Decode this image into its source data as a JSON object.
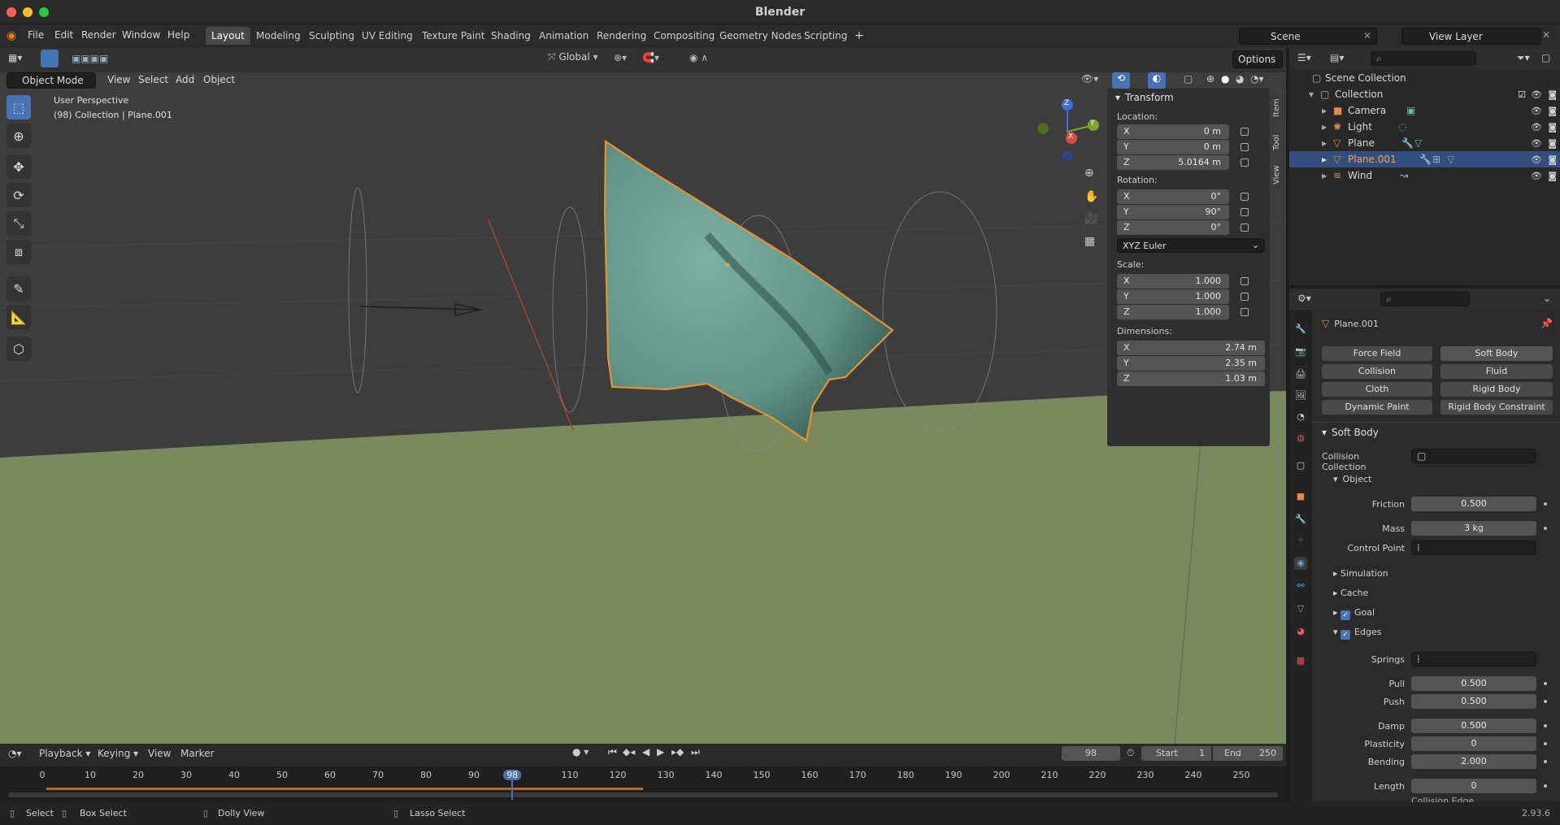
{
  "app_title": "Blender",
  "menu": [
    "File",
    "Edit",
    "Render",
    "Window",
    "Help"
  ],
  "workspaces": [
    "Layout",
    "Modeling",
    "Sculpting",
    "UV Editing",
    "Texture Paint",
    "Shading",
    "Animation",
    "Rendering",
    "Compositing",
    "Geometry Nodes",
    "Scripting"
  ],
  "active_workspace": "Layout",
  "scene_name": "Scene",
  "view_layer": "View Layer",
  "viewport": {
    "mode": "Object Mode",
    "menus": [
      "View",
      "Select",
      "Add",
      "Object"
    ],
    "transform_orientation": "Global",
    "options_label": "Options",
    "info_line1": "User Perspective",
    "info_line2": "(98) Collection | Plane.001",
    "gizmo_axes": [
      "Z",
      "Y",
      "X"
    ]
  },
  "npanel": {
    "header": "Transform",
    "location_label": "Location:",
    "location": [
      {
        "axis": "X",
        "value": "0 m"
      },
      {
        "axis": "Y",
        "value": "0 m"
      },
      {
        "axis": "Z",
        "value": "5.0164 m"
      }
    ],
    "rotation_label": "Rotation:",
    "rotation": [
      {
        "axis": "X",
        "value": "0°"
      },
      {
        "axis": "Y",
        "value": "90°"
      },
      {
        "axis": "Z",
        "value": "0°"
      }
    ],
    "rotation_mode": "XYZ Euler",
    "scale_label": "Scale:",
    "scale": [
      {
        "axis": "X",
        "value": "1.000"
      },
      {
        "axis": "Y",
        "value": "1.000"
      },
      {
        "axis": "Z",
        "value": "1.000"
      }
    ],
    "dimensions_label": "Dimensions:",
    "dimensions": [
      {
        "axis": "X",
        "value": "2.74 m"
      },
      {
        "axis": "Y",
        "value": "2.35 m"
      },
      {
        "axis": "Z",
        "value": "1.03 m"
      }
    ],
    "tabs": [
      "Item",
      "Tool",
      "View"
    ]
  },
  "outliner": {
    "root": "Scene Collection",
    "collection": "Collection",
    "items": [
      "Camera",
      "Light",
      "Plane",
      "Plane.001",
      "Wind"
    ],
    "selected": "Plane.001"
  },
  "properties": {
    "object_name": "Plane.001",
    "physics_buttons": [
      "Force Field",
      "Soft Body",
      "Collision",
      "Fluid",
      "Cloth",
      "Rigid Body",
      "Dynamic Paint",
      "Rigid Body Constraint"
    ],
    "soft_body_header": "Soft Body",
    "collision_collection_label": "Collision Collection",
    "object_sub": "Object",
    "friction_label": "Friction",
    "friction": "0.500",
    "mass_label": "Mass",
    "mass": "3 kg",
    "control_point_label": "Control Point",
    "simulation": "Simulation",
    "cache": "Cache",
    "goal": "Goal",
    "edges": "Edges",
    "springs_label": "Springs",
    "pull_label": "Pull",
    "pull": "0.500",
    "push_label": "Push",
    "push": "0.500",
    "damp_label": "Damp",
    "damp": "0.500",
    "plasticity_label": "Plasticity",
    "plasticity": "0",
    "bending_label": "Bending",
    "bending": "2.000",
    "length_label": "Length",
    "length": "0",
    "collision_edge": "Collision Edge"
  },
  "timeline": {
    "menus": [
      "Playback",
      "Keying",
      "View",
      "Marker"
    ],
    "current_frame": "98",
    "start_label": "Start",
    "start": "1",
    "end_label": "End",
    "end": "250",
    "ticks": [
      "0",
      "10",
      "20",
      "30",
      "40",
      "50",
      "60",
      "70",
      "80",
      "90",
      "98",
      "110",
      "120",
      "130",
      "140",
      "150",
      "160",
      "170",
      "180",
      "190",
      "200",
      "210",
      "220",
      "230",
      "240",
      "250"
    ]
  },
  "statusbar": {
    "select": "Select",
    "box_select": "Box Select",
    "dolly_view": "Dolly View",
    "lasso_select": "Lasso Select",
    "version": "2.93.6"
  },
  "colors": {
    "accent": "#4772b3",
    "selection_outline": "#e8922f",
    "cloth": "#6a9e8f",
    "ground": "#7b8a5e"
  }
}
